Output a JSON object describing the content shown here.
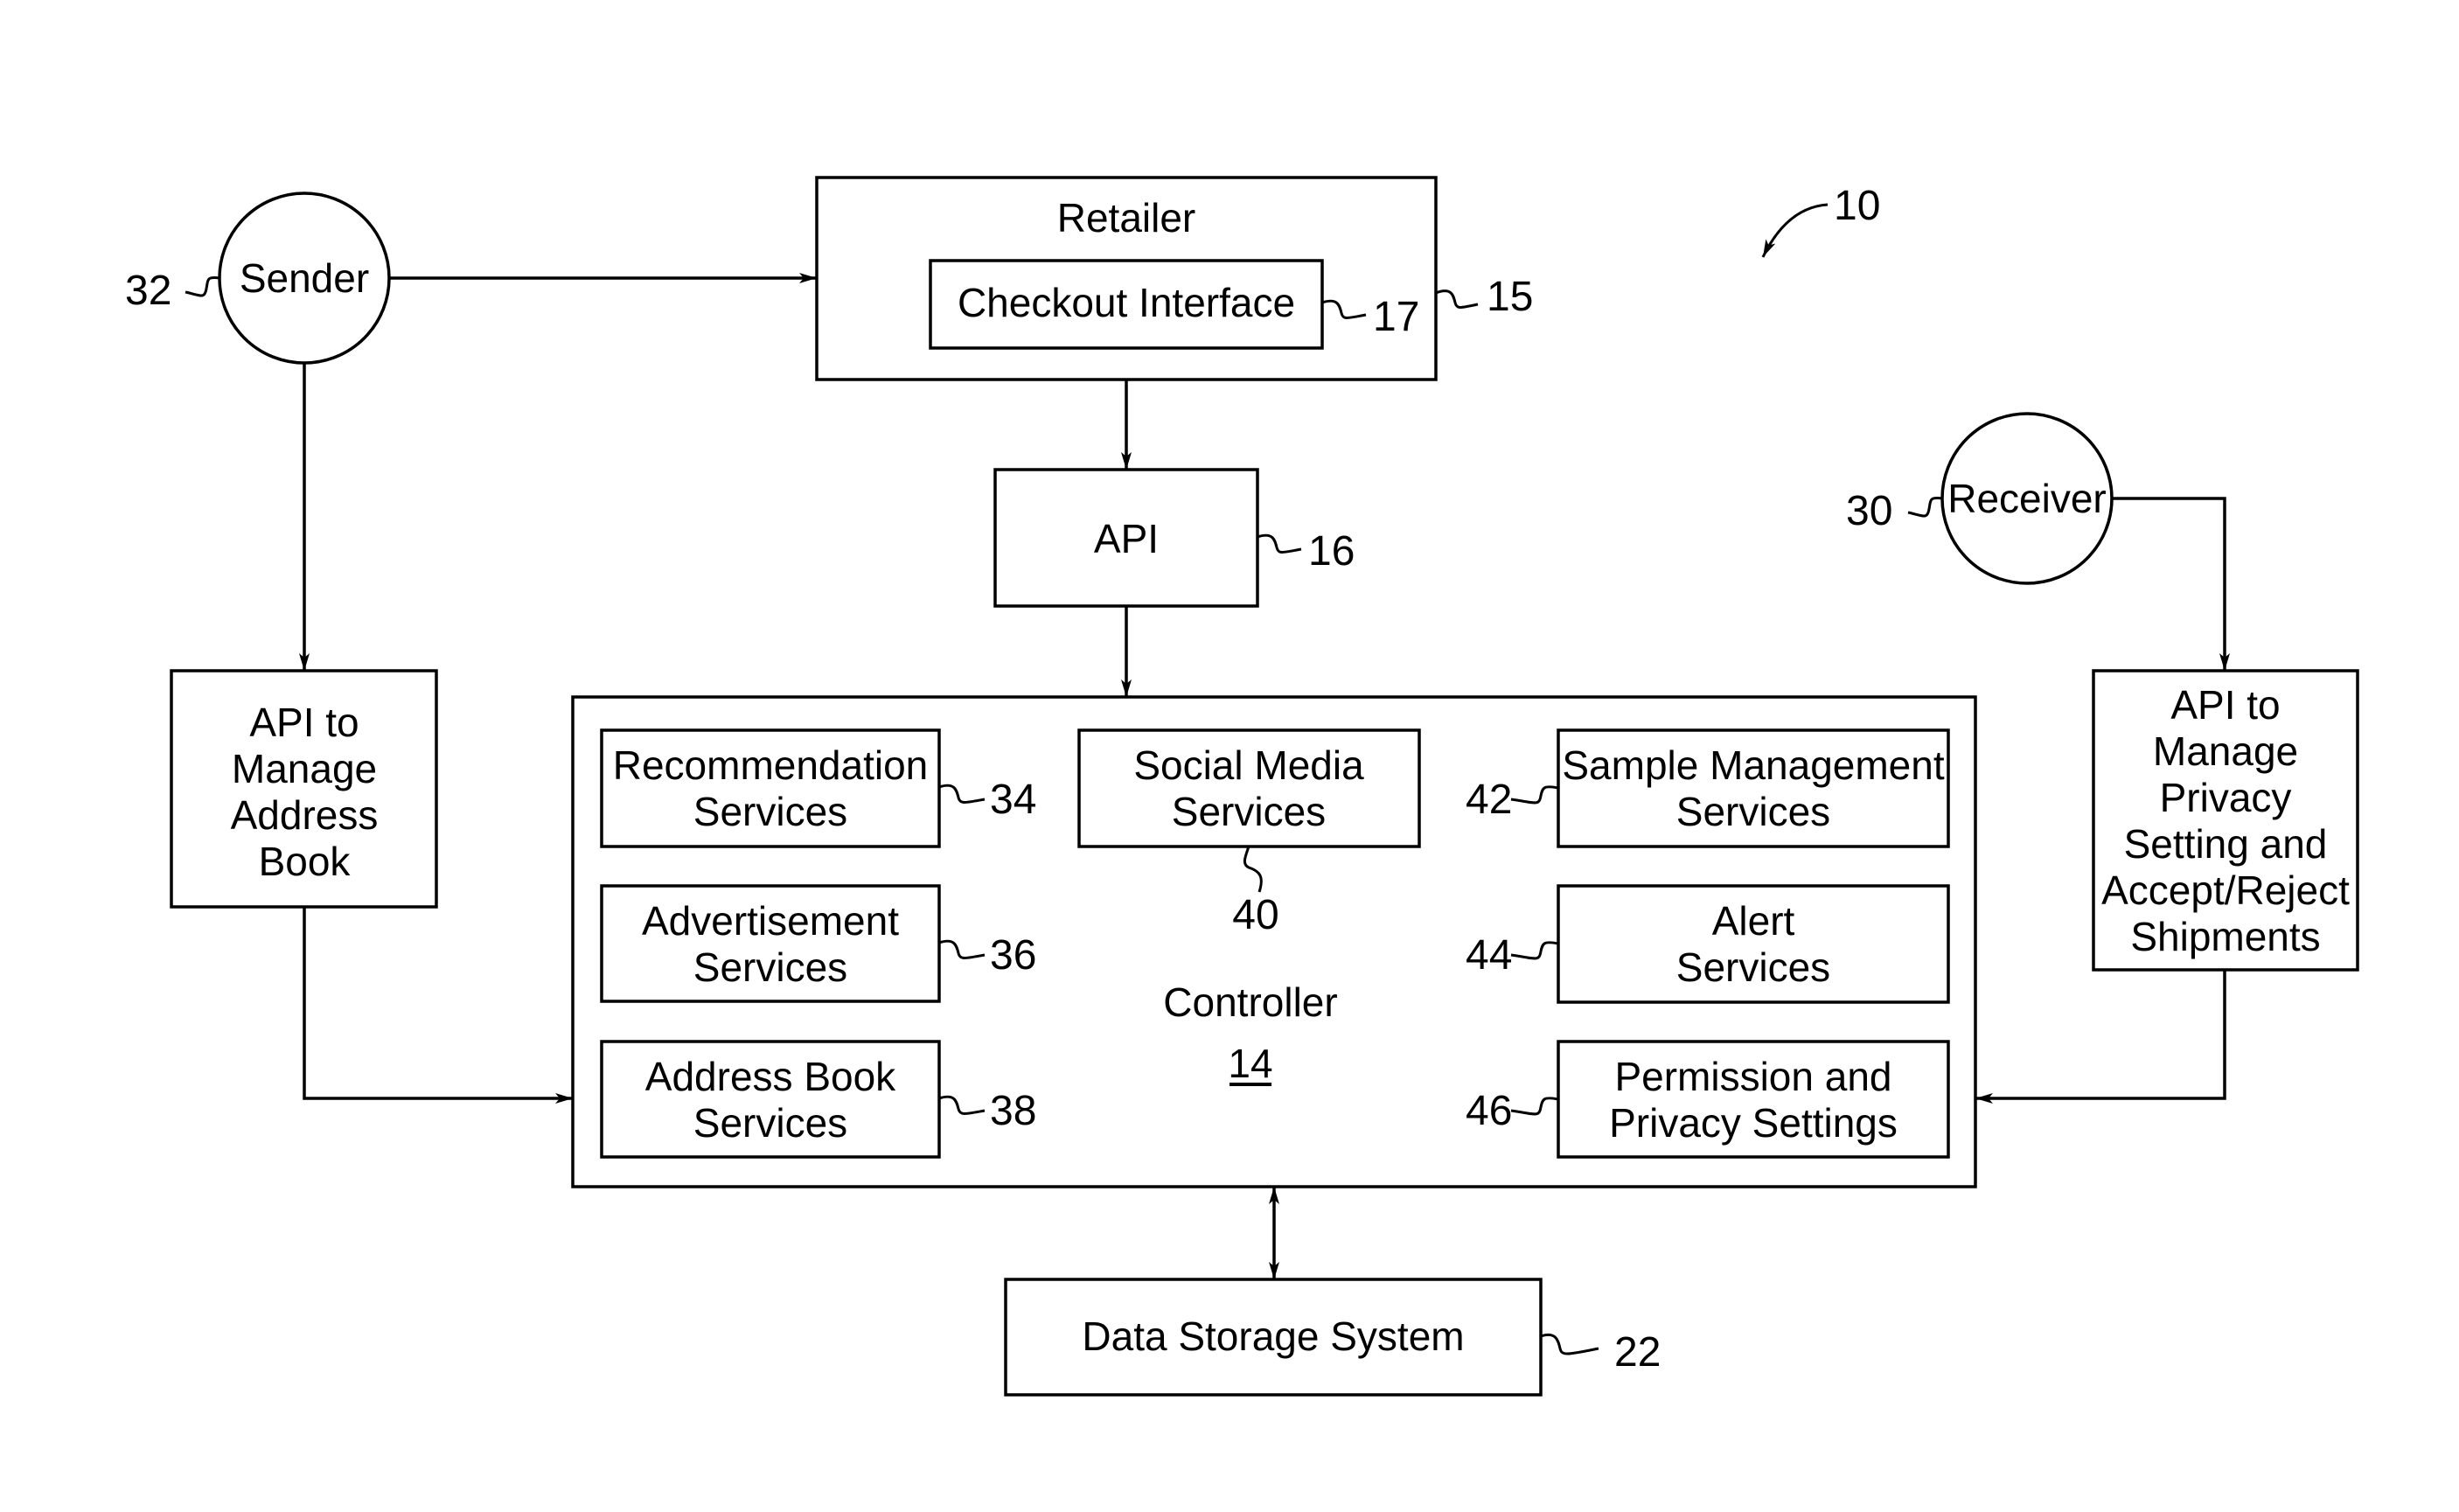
{
  "figure": {
    "reference": "10"
  },
  "nodes": {
    "sender": {
      "label": "Sender",
      "ref": "32"
    },
    "receiver": {
      "label": "Receiver",
      "ref": "30"
    },
    "retailer": {
      "label": "Retailer",
      "ref": "15"
    },
    "checkout": {
      "label": "Checkout Interface",
      "ref": "17"
    },
    "api": {
      "label": "API",
      "ref": "16"
    },
    "api_address_book": {
      "lines": [
        "API to",
        "Manage",
        "Address",
        "Book"
      ]
    },
    "api_privacy": {
      "lines": [
        "API to",
        "Manage",
        "Privacy",
        "Setting and",
        "Accept/Reject",
        "Shipments"
      ]
    },
    "controller": {
      "label": "Controller",
      "ref": "14"
    },
    "data_storage": {
      "label": "Data Storage System",
      "ref": "22"
    }
  },
  "services": {
    "recommendation": {
      "lines": [
        "Recommendation",
        "Services"
      ],
      "ref": "34"
    },
    "advertisement": {
      "lines": [
        "Advertisement",
        "Services"
      ],
      "ref": "36"
    },
    "address_book": {
      "lines": [
        "Address Book",
        "Services"
      ],
      "ref": "38"
    },
    "social_media": {
      "lines": [
        "Social Media",
        "Services"
      ],
      "ref": "40"
    },
    "sample_management": {
      "lines": [
        "Sample Management",
        "Services"
      ],
      "ref": "42"
    },
    "alert": {
      "lines": [
        "Alert",
        "Services"
      ],
      "ref": "44"
    },
    "permission_privacy": {
      "lines": [
        "Permission and",
        "Privacy Settings"
      ],
      "ref": "46"
    }
  },
  "connections": [
    {
      "from": "sender",
      "to": "retailer",
      "direction": "one-way"
    },
    {
      "from": "sender",
      "to": "api_address_book",
      "direction": "one-way"
    },
    {
      "from": "retailer",
      "to": "api",
      "direction": "one-way"
    },
    {
      "from": "api",
      "to": "controller",
      "direction": "one-way"
    },
    {
      "from": "api_address_book",
      "to": "controller",
      "direction": "one-way"
    },
    {
      "from": "receiver",
      "to": "api_privacy",
      "direction": "one-way"
    },
    {
      "from": "api_privacy",
      "to": "controller",
      "direction": "one-way"
    },
    {
      "from": "controller",
      "to": "data_storage",
      "direction": "two-way"
    }
  ]
}
